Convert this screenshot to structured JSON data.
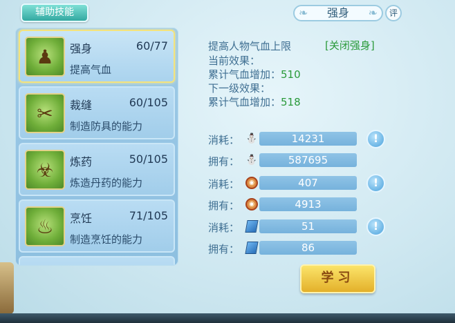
{
  "tab": {
    "label": "辅助技能"
  },
  "skills": [
    {
      "name": "强身",
      "level": "60/77",
      "desc": "提高气血",
      "icon": "muscleman-icon"
    },
    {
      "name": "裁缝",
      "level": "60/105",
      "desc": "制造防具的能力",
      "icon": "scissors-icon"
    },
    {
      "name": "炼药",
      "level": "50/105",
      "desc": "炼造丹药的能力",
      "icon": "cauldron-icon"
    },
    {
      "name": "烹饪",
      "level": "71/105",
      "desc": "制造烹饪的能力",
      "icon": "drumstick-icon"
    }
  ],
  "detail": {
    "title": "强身",
    "comment_label": "评",
    "effect_desc": "提高人物气血上限",
    "close_label": "[关闭强身]",
    "current_label": "当前效果：",
    "current_stat_label": "累计气血增加：",
    "current_value": "510",
    "next_label": "下一级效果：",
    "next_stat_label": "累计气血增加：",
    "next_value": "518"
  },
  "costs": [
    {
      "label": "消耗：",
      "value": "14231",
      "icon": "silver-icon",
      "has_info": true
    },
    {
      "label": "拥有：",
      "value": "587695",
      "icon": "silver-icon",
      "has_info": false
    },
    {
      "label": "消耗：",
      "value": "407",
      "icon": "badge-icon",
      "has_info": true
    },
    {
      "label": "拥有：",
      "value": "4913",
      "icon": "badge-icon",
      "has_info": false
    },
    {
      "label": "消耗：",
      "value": "51",
      "icon": "book-icon",
      "has_info": true
    },
    {
      "label": "拥有：",
      "value": "86",
      "icon": "book-icon",
      "has_info": false
    }
  ],
  "info_glyph": "!",
  "learn_button": {
    "label": "学习"
  }
}
